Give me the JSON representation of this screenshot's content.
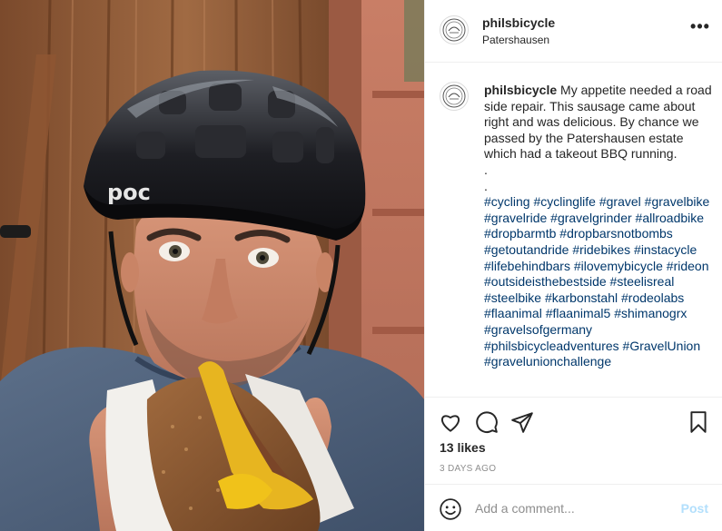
{
  "post": {
    "username": "philsbicycle",
    "location": "Patershausen",
    "caption": {
      "username": "philsbicycle",
      "text": "My appetite needed a road side repair. This sausage came about right and was delicious. By chance we passed by the Patershausen estate which had a takeout BBQ running.",
      "dots": [
        ".",
        "."
      ],
      "hashtags": [
        "#cycling",
        "#cyclinglife",
        "#gravel",
        "#gravelbike",
        "#gravelride",
        "#gravelgrinder",
        "#allroadbike",
        "#dropbarmtb",
        "#dropbarsnotbombs",
        "#getoutandride",
        "#ridebikes",
        "#instacycle",
        "#lifebehindbars",
        "#ilovemybicycle",
        "#rideon",
        "#outsideisthebestside",
        "#steelisreal",
        "#steelbike",
        "#karbonstahl",
        "#rodeolabs",
        "#flaanimal",
        "#flaanimal5",
        "#shimanogrx",
        "#gravelsofgermany",
        "#philsbicycleadventures",
        "#GravelUnion",
        "#gravelunionchallenge"
      ]
    },
    "likes": "13 likes",
    "date": "3 DAYS AGO",
    "photo": {
      "helmet_brand": "poc"
    }
  },
  "comment_box": {
    "placeholder": "Add a comment...",
    "post_label": "Post"
  },
  "icons": {
    "more": "more-options-icon",
    "like": "heart-icon",
    "comment": "comment-bubble-icon",
    "share": "paper-plane-icon",
    "save": "bookmark-icon",
    "emoji": "emoji-icon"
  },
  "colors": {
    "hashtag": "#00376b",
    "text": "#262626",
    "muted": "#8e8e8e",
    "post_disabled": "#b2dffc",
    "border": "#efefef"
  }
}
